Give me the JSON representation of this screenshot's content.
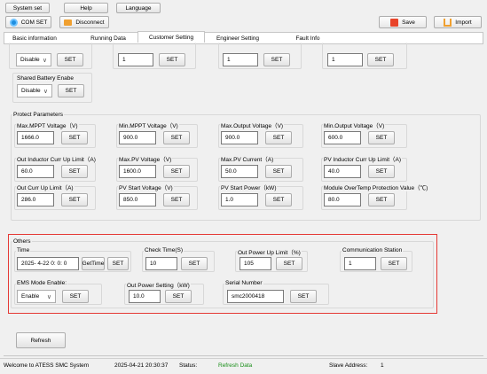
{
  "menu": {
    "system_set": "System set",
    "help": "Help",
    "language": "Language"
  },
  "toolbar": {
    "com_set": "COM SET",
    "disconnect": "Disconnect",
    "save": "Save",
    "import": "Import"
  },
  "tabs": [
    "Basic information",
    "Running Data",
    "Customer Setting",
    "Engineer Setting",
    "Fault Info"
  ],
  "top_row": {
    "select1": "Disable",
    "set": "SET",
    "input2": "1",
    "input3": "1",
    "input4": "1"
  },
  "shared_battery": {
    "title": "Shared Battery Enabe",
    "value": "Disable"
  },
  "protect": {
    "title": "Protect Parameters",
    "fields": [
      {
        "label": "Max.MPPT Voltage（V)",
        "value": "1666.0"
      },
      {
        "label": "Min.MPPT Voltage（V)",
        "value": "900.0"
      },
      {
        "label": "Max.Output Voltage（V)",
        "value": "900.0"
      },
      {
        "label": "Min.Output Voltage（V)",
        "value": "600.0"
      },
      {
        "label": "Out Inductor Curr Up Limit（A)",
        "value": "60.0"
      },
      {
        "label": "Max.PV Voltage（V)",
        "value": "1600.0"
      },
      {
        "label": "Max.PV Current（A)",
        "value": "50.0"
      },
      {
        "label": "PV Inductor Curr Up Limit（A)",
        "value": "40.0"
      },
      {
        "label": "Out Curr Up Limit（A)",
        "value": "286.0"
      },
      {
        "label": "PV Start Voltage（V)",
        "value": "850.0"
      },
      {
        "label": "PV Start Power（kW)",
        "value": "1.0"
      },
      {
        "label": "Module OverTemp Protection Value（℃)",
        "value": "80.0"
      }
    ]
  },
  "others": {
    "title": "Others",
    "time_label": "Time",
    "time_value": "2025- 4-22  0: 0: 0",
    "get_time": "GetTime",
    "check_time_label": "Check Time(S)",
    "check_time_value": "10",
    "out_power_limit_label": "Out Power Up Limit（%)",
    "out_power_limit_value": "105",
    "comm_station_label": "Communication Station",
    "comm_station_value": "1",
    "ems_label": "EMS Mode Enable:",
    "ems_value": "Enable",
    "out_power_setting_label": "Out Power Setting（kW)",
    "out_power_setting_value": "10.0",
    "serial_label": "Serial Number",
    "serial_value": "smc2000418"
  },
  "refresh": "Refresh",
  "status_bar": {
    "welcome": "Welcome to ATESS SMC System",
    "datetime": "2025-04-21 20:30:37",
    "status_label": "Status:",
    "status_value": "Refresh  Data",
    "slave_label": "Slave Address:",
    "slave_value": "1"
  },
  "colors": {
    "highlight_border": "#e53935",
    "status_green": "#1a8f1a"
  }
}
